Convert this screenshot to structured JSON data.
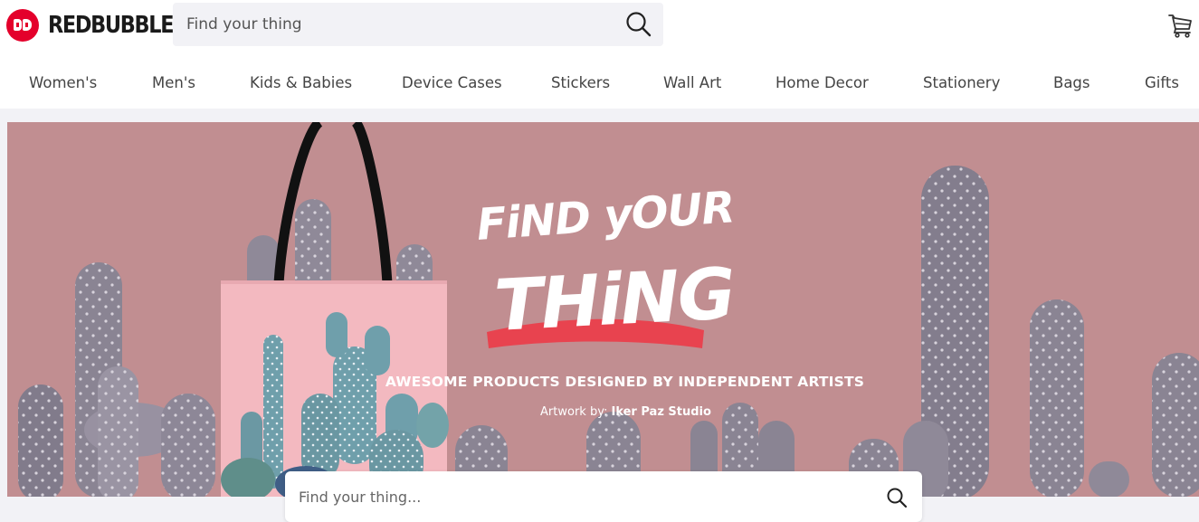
{
  "brand": {
    "name": "REDBUBBLE"
  },
  "header": {
    "search_placeholder": "Find your thing",
    "search_icon": "search-icon",
    "cart_icon": "cart-icon"
  },
  "nav": {
    "items": [
      {
        "label": "Women's"
      },
      {
        "label": "Men's"
      },
      {
        "label": "Kids & Babies"
      },
      {
        "label": "Device Cases"
      },
      {
        "label": "Stickers"
      },
      {
        "label": "Wall Art"
      },
      {
        "label": "Home Decor"
      },
      {
        "label": "Stationery"
      },
      {
        "label": "Bags"
      },
      {
        "label": "Gifts"
      }
    ]
  },
  "hero": {
    "headline_line1": "FiND yOUR",
    "headline_line2": "THiNG",
    "tagline": "AWESOME PRODUCTS DESIGNED BY INDEPENDENT ARTISTS",
    "credit_prefix": "Artwork by:",
    "credit_artist": "Iker Paz Studio",
    "search_placeholder": "Find your thing...",
    "colors": {
      "background": "#c18e91",
      "cactus": "#8a8493",
      "tote": "#f3b9c0",
      "brush": "#e8434f"
    }
  },
  "colors": {
    "brand_red": "#e4002b",
    "search_bg": "#f2f2f6"
  }
}
